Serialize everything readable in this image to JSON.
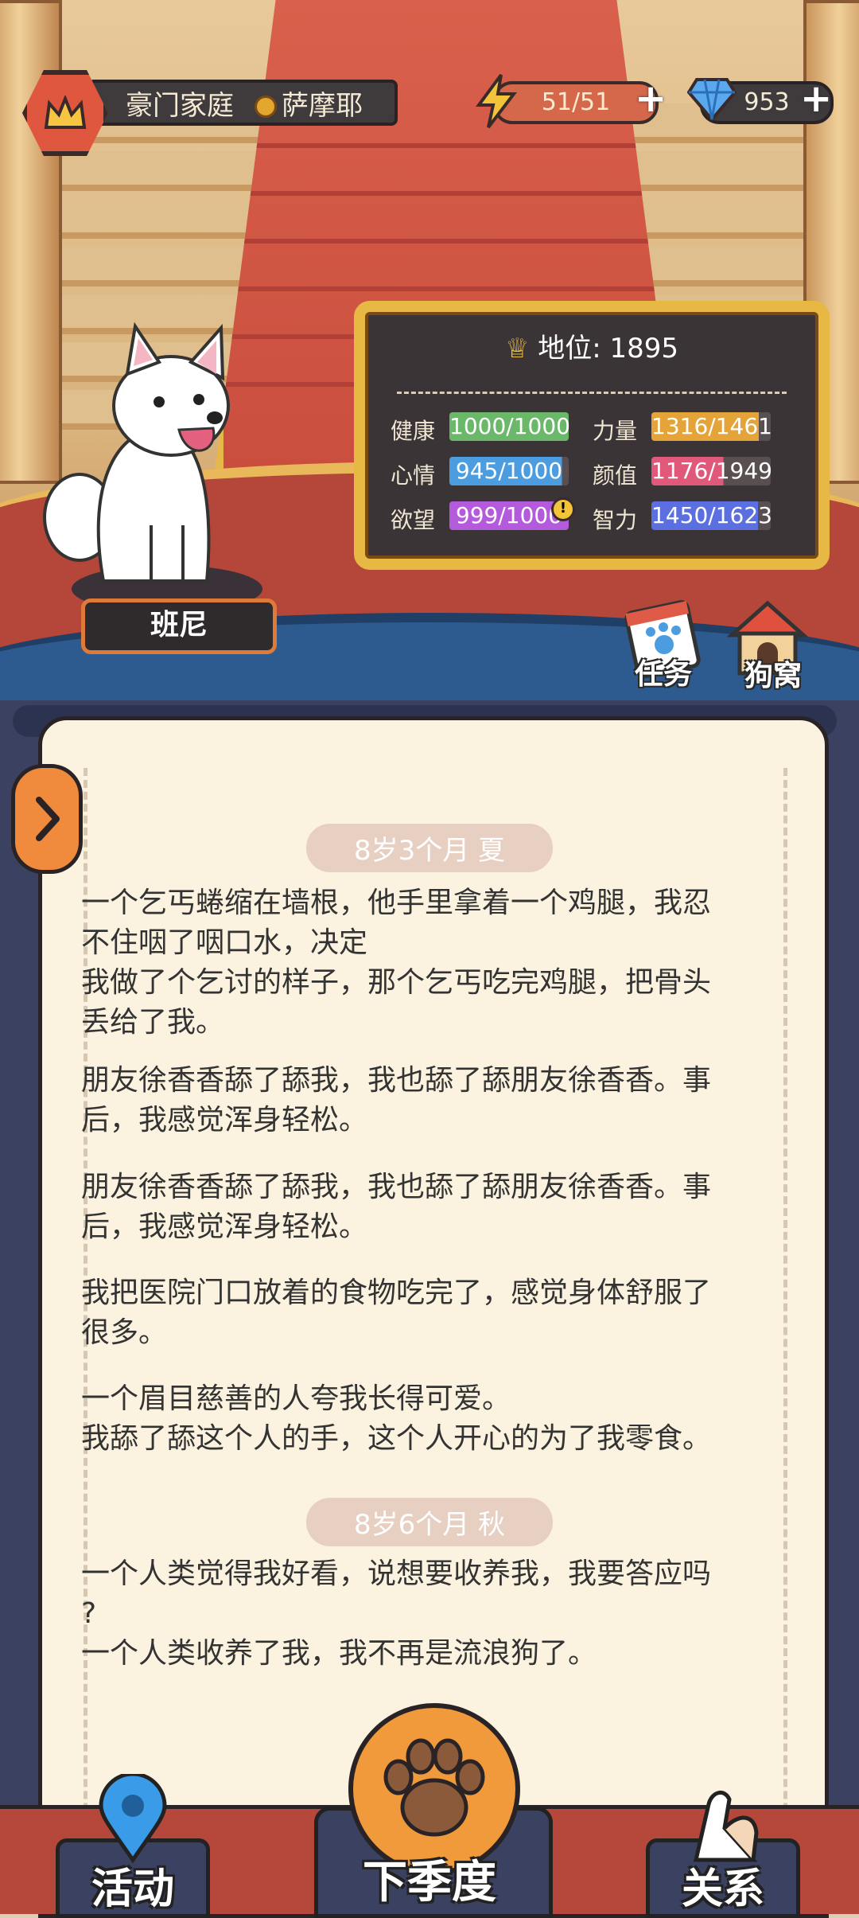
{
  "header": {
    "family_name": "豪门家庭",
    "breed": "萨摩耶",
    "energy": "51/51",
    "gems": "953"
  },
  "dog": {
    "name": "班尼"
  },
  "board": {
    "status": "地位: 1895",
    "stats": [
      {
        "label": "健康",
        "value": "1000/1000",
        "fraction": 1.0,
        "color": "#6bb86a"
      },
      {
        "label": "心情",
        "value": "945/1000",
        "fraction": 0.945,
        "color": "#4c9de0"
      },
      {
        "label": "欲望",
        "value": "999/1000",
        "fraction": 0.999,
        "color": "#b45adc"
      },
      {
        "label": "力量",
        "value": "1316/1461",
        "fraction": 0.9,
        "color": "#e5a43a"
      },
      {
        "label": "颜值",
        "value": "1176/1949",
        "fraction": 0.6034,
        "color": "#e0587a"
      },
      {
        "label": "智力",
        "value": "1450/1623",
        "fraction": 0.8934,
        "color": "#5b6fe0"
      }
    ]
  },
  "side_buttons": {
    "tasks": "任务",
    "kennel": "狗窝"
  },
  "log": {
    "section1": "8岁3个月 夏",
    "entries1": [
      "一个乞丐蜷缩在墙根，他手里拿着一个鸡腿，我忍\n不住咽了咽口水，决定\n我做了个乞讨的样子，那个乞丐吃完鸡腿，把骨头\n丢给了我。",
      "朋友徐香香舔了舔我，我也舔了舔朋友徐香香。事\n后，我感觉浑身轻松。",
      "朋友徐香香舔了舔我，我也舔了舔朋友徐香香。事\n后，我感觉浑身轻松。",
      "我把医院门口放着的食物吃完了，感觉身体舒服了\n很多。",
      "一个眉目慈善的人夸我长得可爱。\n我舔了舔这个人的手，这个人开心的为了我零食。"
    ],
    "section2": "8岁6个月 秋",
    "entries2": [
      "一个人类觉得我好看，说想要收养我，我要答应吗\n?\n一个人类收养了我，我不再是流浪狗了。"
    ]
  },
  "nav": {
    "activity": "活动",
    "next_season": "下季度",
    "relations": "关系"
  }
}
